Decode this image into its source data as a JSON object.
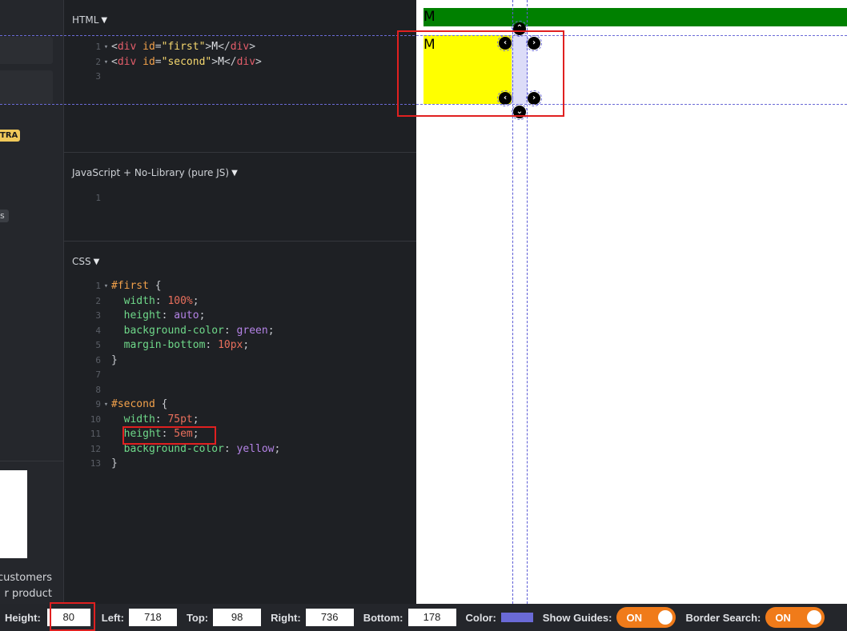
{
  "sidebar": {
    "badge": "TRA",
    "tag": "s",
    "text_line1": "r customers",
    "text_line2": "r product"
  },
  "html_panel": {
    "title": "HTML",
    "lines": [
      {
        "n": "1",
        "fold": "▾"
      },
      {
        "n": "2",
        "fold": "▾"
      },
      {
        "n": "3",
        "fold": ""
      }
    ],
    "code": {
      "l1_open": "<",
      "l1_tag": "div",
      "l1_attr": "id",
      "l1_eq": "=",
      "l1_val": "\"first\"",
      "l1_gt": ">",
      "l1_text": "M",
      "l1_close": "</",
      "l1_ctag": "div",
      "l1_end": ">",
      "l2_val": "\"second\"",
      "l2_text": "M"
    }
  },
  "js_panel": {
    "title": "JavaScript + No-Library (pure JS)",
    "line": "1"
  },
  "css_panel": {
    "title": "CSS",
    "rules": {
      "first_selector": "#first",
      "first_props": [
        {
          "prop": "width",
          "val": "100%"
        },
        {
          "prop": "height",
          "val": "auto"
        },
        {
          "prop": "background-color",
          "val": "green"
        },
        {
          "prop": "margin-bottom",
          "val": "10px"
        }
      ],
      "second_selector": "#second",
      "second_props": [
        {
          "prop": "width",
          "val": "75pt"
        },
        {
          "prop": "height",
          "val": "5em"
        },
        {
          "prop": "background-color",
          "val": "yellow"
        }
      ]
    },
    "line_numbers": [
      "1",
      "2",
      "3",
      "4",
      "5",
      "6",
      "7",
      "8",
      "9",
      "10",
      "11",
      "12",
      "13"
    ]
  },
  "preview": {
    "first_text": "M",
    "second_text": "M",
    "colors": {
      "first": "#008000",
      "second": "#ffff00",
      "guide": "#6a6ad6",
      "highlight": "#dcdcf8"
    }
  },
  "toolbar": {
    "height_label": "Height:",
    "height_value": "80",
    "left_label": "Left:",
    "left_value": "718",
    "top_label": "Top:",
    "top_value": "98",
    "right_label": "Right:",
    "right_value": "736",
    "bottom_label": "Bottom:",
    "bottom_value": "178",
    "color_label": "Color:",
    "color_value": "#6a6ad6",
    "guides_label": "Show Guides:",
    "guides_state": "ON",
    "border_label": "Border Search:",
    "border_state": "ON"
  }
}
